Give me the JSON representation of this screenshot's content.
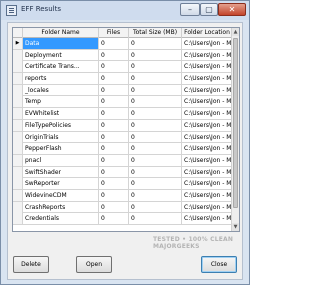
{
  "window": {
    "title": "EFF Results",
    "icon": "app-icon",
    "controls": {
      "minimize": "–",
      "maximize": "▢",
      "close": "✕"
    }
  },
  "grid": {
    "columns": [
      "",
      "Folder Name",
      "Files",
      "Total Size (MB)",
      "Folder Location"
    ],
    "rows": [
      {
        "name": "Data",
        "files": "0",
        "size": "0",
        "location": "C:\\Users\\Jon - Ma...",
        "selected": true
      },
      {
        "name": "Deployment",
        "files": "0",
        "size": "0",
        "location": "C:\\Users\\Jon - Ma..."
      },
      {
        "name": "Certificate Trans...",
        "files": "0",
        "size": "0",
        "location": "C:\\Users\\Jon - Ma..."
      },
      {
        "name": "reports",
        "files": "0",
        "size": "0",
        "location": "C:\\Users\\Jon - Ma..."
      },
      {
        "name": "_locales",
        "files": "0",
        "size": "0",
        "location": "C:\\Users\\Jon - Ma..."
      },
      {
        "name": "Temp",
        "files": "0",
        "size": "0",
        "location": "C:\\Users\\Jon - Ma..."
      },
      {
        "name": "EVWhitelist",
        "files": "0",
        "size": "0",
        "location": "C:\\Users\\Jon - Ma..."
      },
      {
        "name": "FileTypePolicies",
        "files": "0",
        "size": "0",
        "location": "C:\\Users\\Jon - Ma..."
      },
      {
        "name": "OriginTrials",
        "files": "0",
        "size": "0",
        "location": "C:\\Users\\Jon - Ma..."
      },
      {
        "name": "PepperFlash",
        "files": "0",
        "size": "0",
        "location": "C:\\Users\\Jon - Ma..."
      },
      {
        "name": "pnacl",
        "files": "0",
        "size": "0",
        "location": "C:\\Users\\Jon - Ma..."
      },
      {
        "name": "SwiftShader",
        "files": "0",
        "size": "0",
        "location": "C:\\Users\\Jon - Ma..."
      },
      {
        "name": "SwReporter",
        "files": "0",
        "size": "0",
        "location": "C:\\Users\\Jon - Ma..."
      },
      {
        "name": "WidevineCDM",
        "files": "0",
        "size": "0",
        "location": "C:\\Users\\Jon - Ma..."
      },
      {
        "name": "CrashReports",
        "files": "0",
        "size": "0",
        "location": "C:\\Users\\Jon - Ma..."
      },
      {
        "name": "Credentials",
        "files": "0",
        "size": "0",
        "location": "C:\\Users\\Jon - Ma..."
      }
    ],
    "row_selector_glyph": "▶"
  },
  "buttons": {
    "delete": "Delete",
    "open": "Open",
    "close": "Close"
  },
  "watermark": "TESTED • 100% CLEAN MAJORGEEKS",
  "colors": {
    "selection": "#3399ff",
    "window_frame": "#d9e4f1"
  }
}
